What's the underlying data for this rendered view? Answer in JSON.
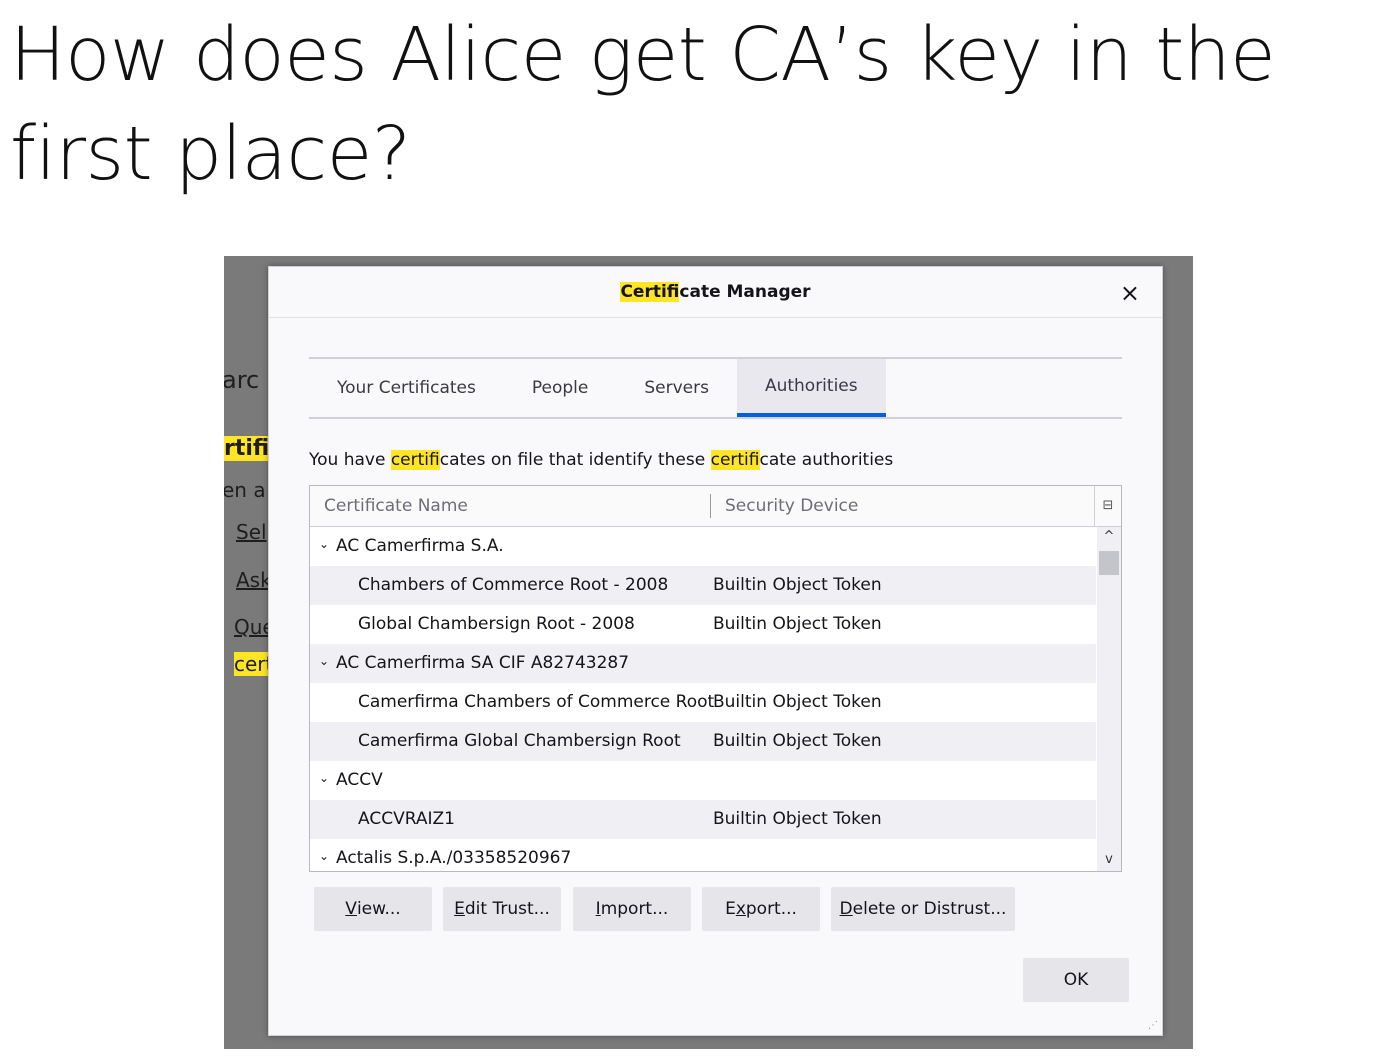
{
  "slide": {
    "title_line1": "How does Alice get CA’s key in the",
    "title_line2": "first place?"
  },
  "background": {
    "fragments": [
      "arc",
      "rtific",
      "en a",
      "Sel",
      "Ask",
      "Que",
      "cert"
    ]
  },
  "dialog": {
    "title_hl": "Certif",
    "title_rest": "icate Manager",
    "close_icon": "×",
    "tabs": [
      "Your Certificates",
      "People",
      "Servers",
      "Authorities"
    ],
    "active_tab": "Authorities",
    "intro": {
      "part1": "You have ",
      "hl1": "certif",
      "part2": "icates on file that identify these ",
      "hl2": "certif",
      "part3": "icate authorities"
    },
    "columns": {
      "name": "Certificate Name",
      "device": "Security Device",
      "picker_icon": "⊟"
    },
    "rows": [
      {
        "type": "group",
        "name": "AC Camerfirma S.A.",
        "device": ""
      },
      {
        "type": "item",
        "name": "Chambers of Commerce Root - 2008",
        "device": "Builtin Object Token"
      },
      {
        "type": "item",
        "name": "Global Chambersign Root - 2008",
        "device": "Builtin Object Token"
      },
      {
        "type": "group",
        "name": "AC Camerfirma SA CIF A82743287",
        "device": ""
      },
      {
        "type": "item",
        "name": "Camerfirma Chambers of Commerce Root",
        "device": "Builtin Object Token"
      },
      {
        "type": "item",
        "name": "Camerfirma Global Chambersign Root",
        "device": "Builtin Object Token"
      },
      {
        "type": "group",
        "name": "ACCV",
        "device": ""
      },
      {
        "type": "item",
        "name": "ACCVRAIZ1",
        "device": "Builtin Object Token"
      },
      {
        "type": "group",
        "name": "Actalis S.p.A./03358520967",
        "device": ""
      }
    ],
    "buttons": {
      "view": {
        "ul": "V",
        "rest": "iew..."
      },
      "edit": {
        "ul": "E",
        "rest": "dit Trust..."
      },
      "import": {
        "pre": "",
        "ul": "I",
        "rest": "mport..."
      },
      "export": {
        "pre": "E",
        "ul": "x",
        "rest": "port..."
      },
      "delete": {
        "ul": "D",
        "rest": "elete or Distrust..."
      },
      "ok": "OK"
    }
  }
}
